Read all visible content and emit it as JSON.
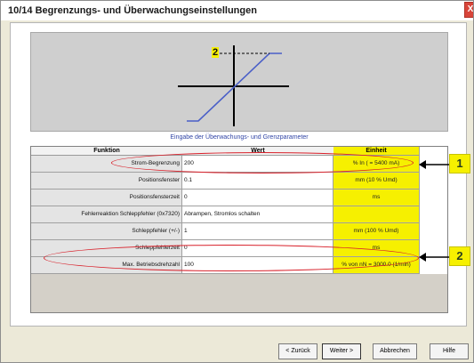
{
  "window": {
    "title": "10/14 Begrenzungs- und Überwachungseinstellungen",
    "close_glyph": "X"
  },
  "diagram": {
    "marker_label": "2"
  },
  "caption": "Eingabe der Überwachungs- und Grenzparameter",
  "table": {
    "headers": {
      "function": "Funktion",
      "value": "Wert",
      "unit": "Einheit"
    },
    "rows": [
      {
        "function": "Strom-Begrenzung",
        "value": "200",
        "unit": "% In ( = 5400 mA)"
      },
      {
        "function": "Positionsfenster",
        "value": "0.1",
        "unit": "mm (10 % Umd)"
      },
      {
        "function": "Positionsfensterzeit",
        "value": "0",
        "unit": "ms"
      },
      {
        "function": "Fehlerreaktion Schleppfehler (0x7320)",
        "value": "Abrampen, Stromlos schalten",
        "unit": ""
      },
      {
        "function": "Schleppfehler (+/-)",
        "value": "1",
        "unit": "mm (100 % Umd)"
      },
      {
        "function": "Schleppfehlerzeit",
        "value": "0",
        "unit": "ms"
      },
      {
        "function": "Max. Betriebsdrehzahl",
        "value": "100",
        "unit": "% von nN = 3000.0 (1/min)"
      }
    ]
  },
  "callouts": {
    "one": "1",
    "two": "2"
  },
  "buttons": {
    "back": "< Zurück",
    "next": "Weiter >",
    "cancel": "Abbrechen",
    "help": "Hilfe"
  },
  "colors": {
    "highlight": "#f6f000",
    "annotation": "#d8202a",
    "curve": "#4a5fc8"
  }
}
